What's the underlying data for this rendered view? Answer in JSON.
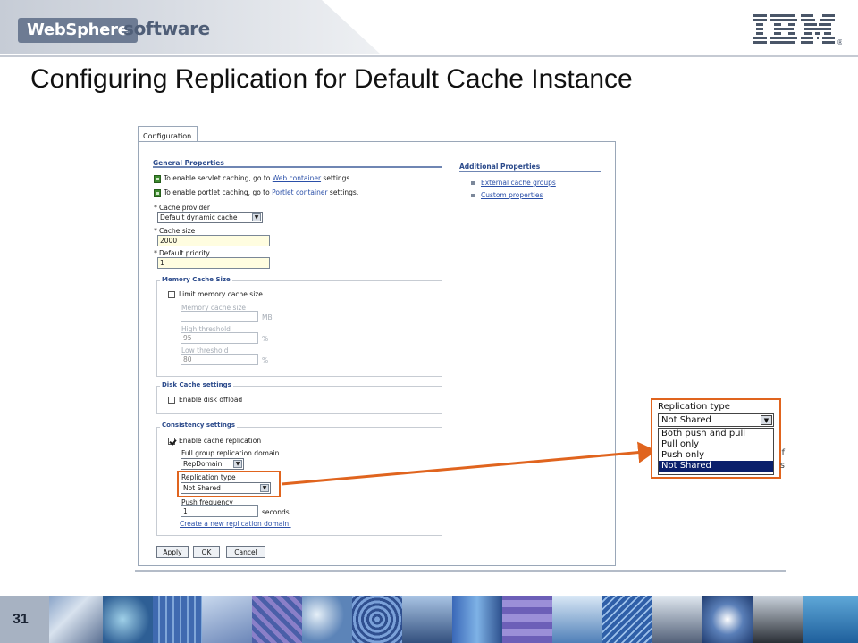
{
  "header": {
    "product_name": "WebSphere",
    "product_suffix": "software",
    "company_logo_text": "IBM",
    "trademark": "®"
  },
  "slide": {
    "title": "Configuring Replication for Default Cache Instance",
    "page_number": "31"
  },
  "console": {
    "tab_label": "Configuration",
    "general_properties_heading": "General Properties",
    "info_line_1": {
      "prefix": "To enable servlet caching, go to ",
      "link": "Web container",
      "suffix": " settings."
    },
    "info_line_2": {
      "prefix": "To enable portlet caching, go to ",
      "link": "Portlet container",
      "suffix": " settings."
    },
    "required_marker": "*",
    "cache_provider": {
      "label": "Cache provider",
      "value": "Default dynamic cache"
    },
    "cache_size": {
      "label": "Cache size",
      "value": "2000"
    },
    "default_priority": {
      "label": "Default priority",
      "value": "1"
    },
    "memory_cache": {
      "legend": "Memory Cache Size",
      "limit_label": "Limit memory cache size",
      "limit_checked": false,
      "size_label": "Memory cache size",
      "size_value": "",
      "size_unit": "MB",
      "high_label": "High threshold",
      "high_value": "95",
      "high_unit": "%",
      "low_label": "Low threshold",
      "low_value": "80",
      "low_unit": "%"
    },
    "disk_cache": {
      "legend": "Disk Cache settings",
      "offload_label": "Enable disk offload",
      "offload_checked": false
    },
    "consistency": {
      "legend": "Consistency settings",
      "replication_label": "Enable cache replication",
      "replication_checked": true,
      "domain_label": "Full group replication domain",
      "domain_value": "RepDomain",
      "type_label": "Replication type",
      "type_value": "Not Shared",
      "push_label": "Push frequency",
      "push_value": "1",
      "push_unit": "seconds",
      "create_link": "Create a new replication domain."
    },
    "buttons": {
      "apply": "Apply",
      "ok": "OK",
      "cancel": "Cancel"
    },
    "additional_properties": {
      "heading": "Additional Properties",
      "links": [
        "External cache groups",
        "Custom properties"
      ]
    }
  },
  "zoom_dropdown": {
    "label": "Replication type",
    "selected": "Not Shared",
    "options": [
      "Both push and pull",
      "Pull only",
      "Push only",
      "Not Shared"
    ],
    "highlighted_index": 3,
    "edge_glyphs": [
      "f",
      "s"
    ]
  },
  "colors": {
    "highlight": "#e0641e",
    "title_text": "#111111",
    "link": "#2a4fa8",
    "section_heading": "#2b4a8b",
    "selected_option_bg": "#0a1f6b",
    "footer_bg": "#3a4b62"
  },
  "footer_tiles": [
    "person-photo-tile",
    "blue-swirl-tile",
    "blue-grid-tile",
    "blue-lines-tile",
    "purple-mosaic-tile",
    "water-drops-tile",
    "blue-dots-tile",
    "mountain-tile",
    "blue-tech-tile",
    "purple-squares-tile",
    "ocean-tile",
    "grid-lines-tile",
    "bridge-tile",
    "earth-tile",
    "light-burst-tile",
    "tree-silhouette-tile",
    "red-bridge-tile",
    "red-tile",
    "ocean-waves-tile"
  ]
}
